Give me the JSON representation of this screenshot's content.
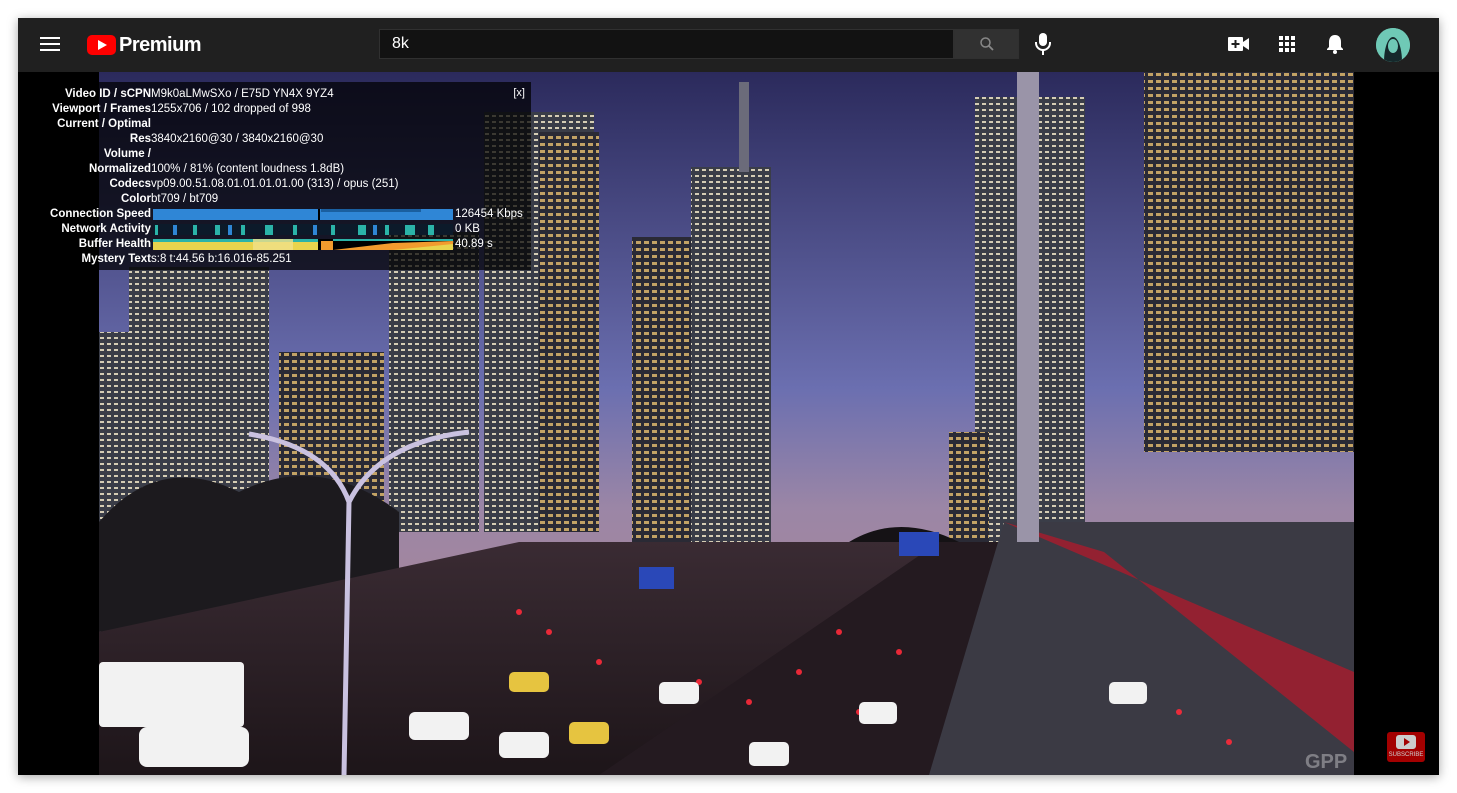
{
  "header": {
    "logo_text": "Premium",
    "search": {
      "value": "8k"
    }
  },
  "stats": {
    "close_label": "[x]",
    "rows": [
      {
        "key": "Video ID / sCPN",
        "value": "M9k0aLMwSXo / E75D YN4X 9YZ4"
      },
      {
        "key": "Viewport / Frames",
        "value": "1255x706 / 102 dropped of 998"
      },
      {
        "key": "Current / Optimal",
        "value": ""
      },
      {
        "key": "Res",
        "value": "3840x2160@30 / 3840x2160@30"
      },
      {
        "key": "Volume /",
        "value": ""
      },
      {
        "key": "Normalized",
        "value": "100% / 81% (content loudness 1.8dB)"
      },
      {
        "key": "Codecs",
        "value": "vp09.00.51.08.01.01.01.01.00 (313) / opus (251)"
      },
      {
        "key": "Color",
        "value": "bt709 / bt709"
      }
    ],
    "connection_speed": {
      "key": "Connection Speed",
      "value": "126454 Kbps"
    },
    "network_activity": {
      "key": "Network Activity",
      "value": "0 KB"
    },
    "buffer_health": {
      "key": "Buffer Health",
      "value": "40.89 s"
    },
    "mystery_text": {
      "key": "Mystery Text",
      "value": "s:8 t:44.56 b:16.016-85.251"
    }
  },
  "overlay": {
    "subscribe_label": "SUBSCRIBE",
    "watermark": "GPP"
  },
  "colors": {
    "topbar": "#202020",
    "brand_red": "#ff0000",
    "graph_blue": "#2f86d6",
    "graph_yellow": "#e8d44d",
    "graph_orange": "#f29b2e",
    "graph_teal": "#2bb3a8"
  }
}
